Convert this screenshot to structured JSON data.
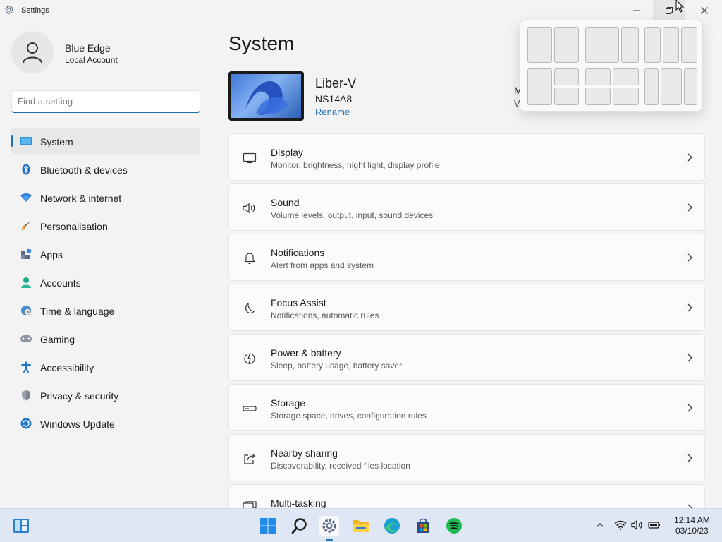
{
  "window": {
    "title": "Settings"
  },
  "profile": {
    "name": "Blue Edge",
    "account_type": "Local Account"
  },
  "search": {
    "placeholder": "Find a setting"
  },
  "nav": {
    "items": [
      {
        "label": "System",
        "icon": "monitor-icon",
        "active": true
      },
      {
        "label": "Bluetooth & devices",
        "icon": "bluetooth-icon"
      },
      {
        "label": "Network & internet",
        "icon": "wifi-icon"
      },
      {
        "label": "Personalisation",
        "icon": "brush-icon"
      },
      {
        "label": "Apps",
        "icon": "apps-icon"
      },
      {
        "label": "Accounts",
        "icon": "person-icon"
      },
      {
        "label": "Time & language",
        "icon": "globe-clock-icon"
      },
      {
        "label": "Gaming",
        "icon": "gamepad-icon"
      },
      {
        "label": "Accessibility",
        "icon": "accessibility-icon"
      },
      {
        "label": "Privacy & security",
        "icon": "shield-icon"
      },
      {
        "label": "Windows Update",
        "icon": "update-icon"
      }
    ]
  },
  "main": {
    "title": "System",
    "device": {
      "name": "Liber-V",
      "model": "NS14A8",
      "rename_label": "Rename"
    },
    "peek_text_1": "M",
    "peek_text_2": "V",
    "cards": [
      {
        "title": "Display",
        "subtitle": "Monitor, brightness, night light, display profile",
        "icon": "display-icon"
      },
      {
        "title": "Sound",
        "subtitle": "Volume levels, output, input, sound devices",
        "icon": "speaker-icon"
      },
      {
        "title": "Notifications",
        "subtitle": "Alert from apps and system",
        "icon": "bell-icon"
      },
      {
        "title": "Focus Assist",
        "subtitle": "Notifications, automatic rules",
        "icon": "moon-icon"
      },
      {
        "title": "Power & battery",
        "subtitle": "Sleep, battery usage, battery saver",
        "icon": "power-icon"
      },
      {
        "title": "Storage",
        "subtitle": "Storage space, drives, configuration rules",
        "icon": "storage-icon"
      },
      {
        "title": "Nearby sharing",
        "subtitle": "Discoverability, received files location",
        "icon": "share-icon"
      },
      {
        "title": "Multi-tasking",
        "subtitle": "",
        "icon": "multitask-icon"
      }
    ]
  },
  "taskbar": {
    "apps": [
      "widgets-icon",
      "start-icon",
      "search-icon",
      "settings-icon",
      "file-explorer-icon",
      "edge-icon",
      "store-icon",
      "spotify-icon"
    ],
    "clock": {
      "time": "12:14 AM",
      "date": "03/10/23"
    }
  },
  "colors": {
    "accent": "#1f6fb3",
    "background": "#f3f3f3",
    "card": "#fbfbfb",
    "taskbar": "#dfe7f4"
  }
}
